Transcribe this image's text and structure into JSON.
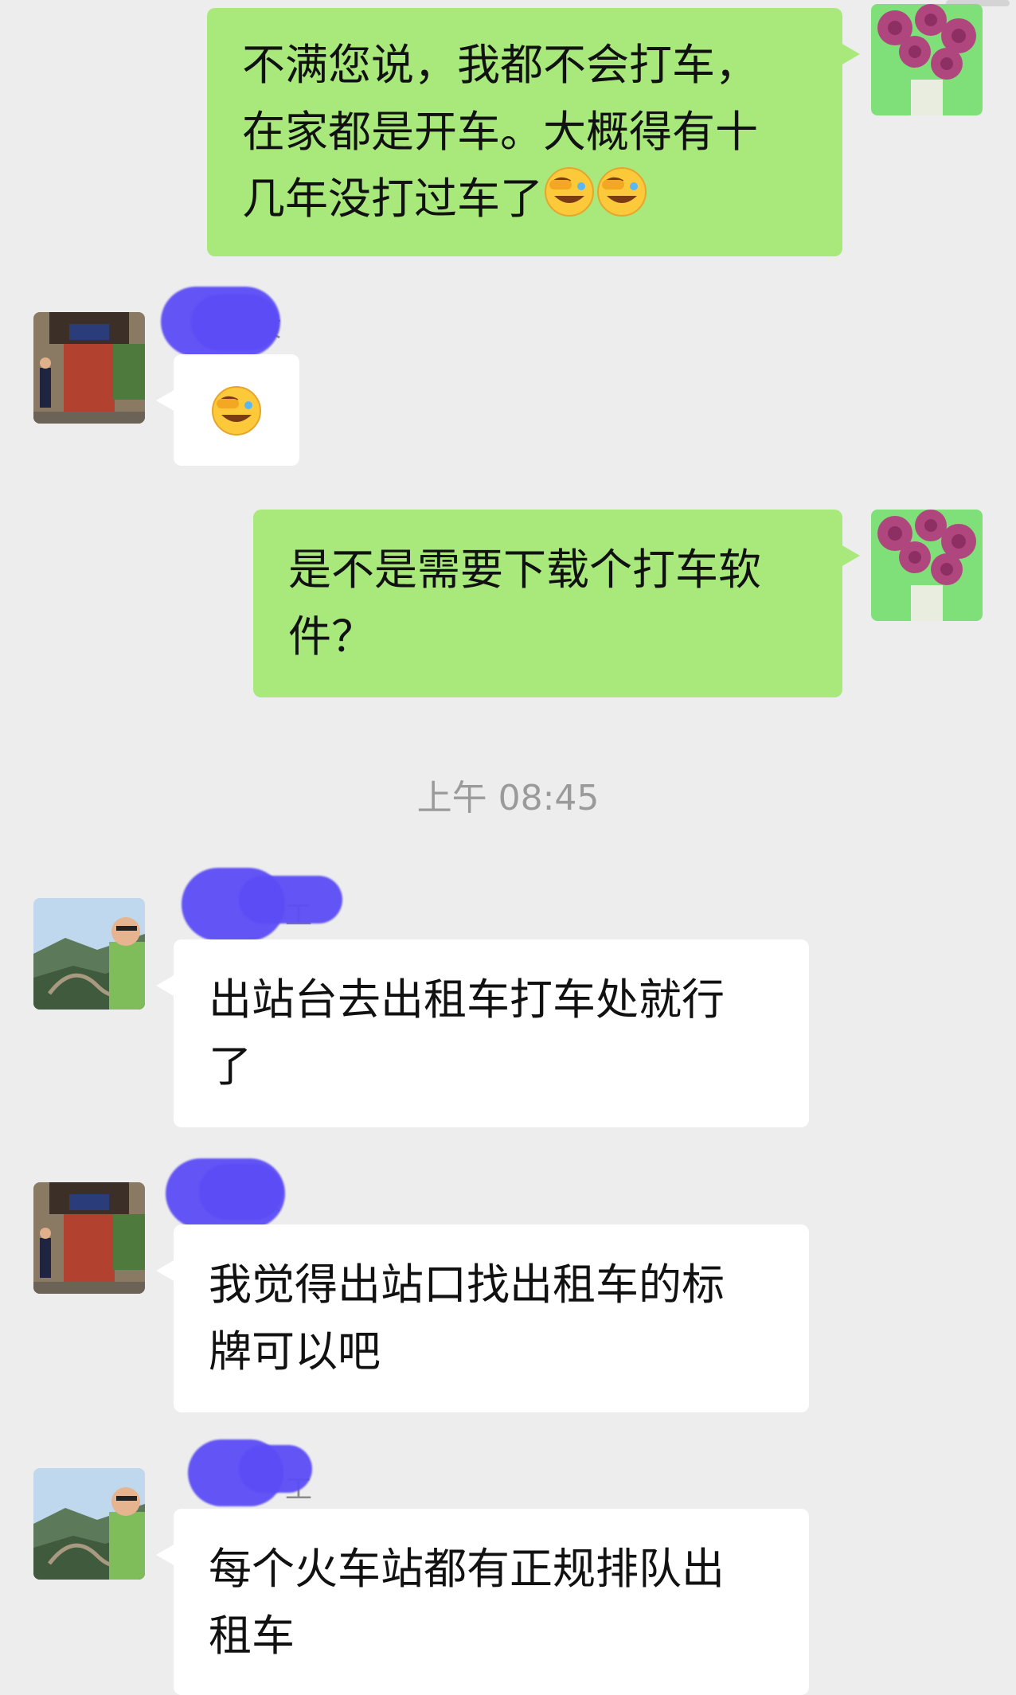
{
  "chat": {
    "timestamp": "上午 08:45",
    "messages": [
      {
        "side": "me",
        "text": "不满您说，我都不会打车，在家都是开车。大概得有十几年没打过车了",
        "emoji": "facepalm-laugh-emoji x2"
      },
      {
        "side": "them",
        "sender_partial": "贡",
        "emoji_only": "facepalm-laugh-emoji"
      },
      {
        "side": "me",
        "text": "是不是需要下载个打车软件？"
      },
      {
        "side": "them",
        "sender_partial": "工",
        "text": "出站台去出租车打车处就行了"
      },
      {
        "side": "them",
        "sender_partial": "贡",
        "text": "我觉得出站口找出租车的标牌可以吧"
      },
      {
        "side": "them",
        "sender_partial": "工",
        "text": "每个火车站都有正规排队出租车"
      }
    ]
  },
  "msg1": {
    "line1": "不满您说，我都不会打车，",
    "line2": "在家都是开车。大概得有十",
    "line3": "几年没打过车了"
  },
  "msg2": {
    "sender": "贡"
  },
  "msg3": {
    "line1": "是不是需要下载个打车软",
    "line2": "件？"
  },
  "msg4": {
    "sender": "工",
    "line1": "出站台去出租车打车处就行",
    "line2": "了"
  },
  "msg5": {
    "sender": "贡",
    "line1": "我觉得出站口找出租车的标",
    "line2": "牌可以吧"
  },
  "msg6": {
    "sender": "工",
    "line1": "每个火车站都有正规排队出",
    "line2": "租车"
  },
  "icons": {
    "me_avatar": "roses-avatar",
    "them1_avatar": "temple-gate-avatar",
    "them2_avatar": "great-wall-avatar",
    "emoji": "facepalm-laugh-emoji"
  },
  "colors": {
    "me_bubble": "#a9e97c",
    "them_bubble": "#ffffff",
    "background": "#ededed",
    "redaction": "#5b4cf6"
  }
}
